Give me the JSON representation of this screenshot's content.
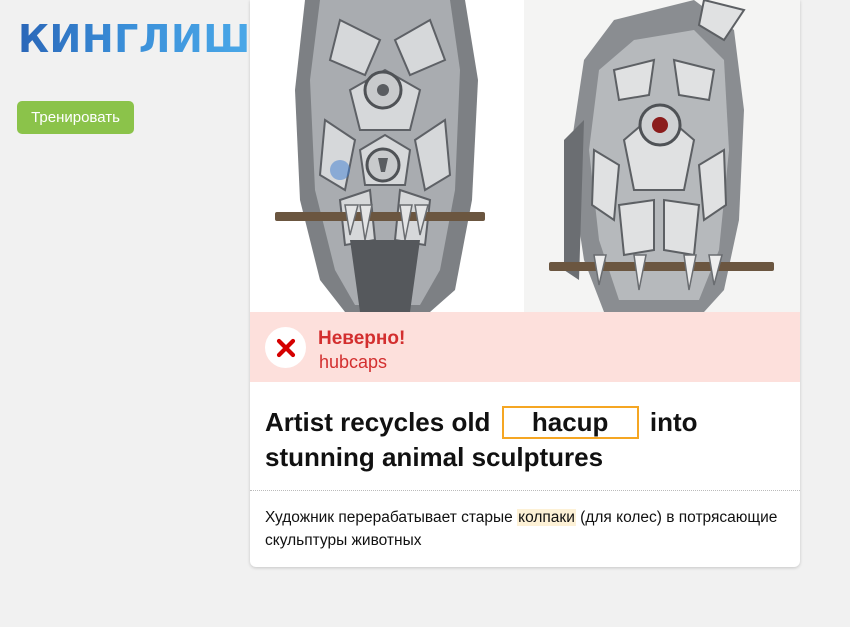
{
  "app": {
    "logo_text": "КИНГЛИШ"
  },
  "sidebar": {
    "train_button_label": "Тренировать"
  },
  "feedback": {
    "status": "Неверно!",
    "correct_answer": "hubcaps",
    "status_color": "#d32f2f",
    "background_color": "#fde0dc"
  },
  "exercise": {
    "sentence_before": "Artist recycles old",
    "user_answer": "hacup",
    "sentence_after": "into stunning animal sculptures",
    "translation_before": "Художник перерабатывает старые",
    "translation_highlight": "колпаки",
    "translation_after": "(для колес) в потрясающие скульптуры животных"
  },
  "colors": {
    "accent_green": "#8bc34a",
    "blank_border": "#f5a623",
    "highlight": "#fdf1d6"
  },
  "icons": [
    "x-mark-icon"
  ]
}
